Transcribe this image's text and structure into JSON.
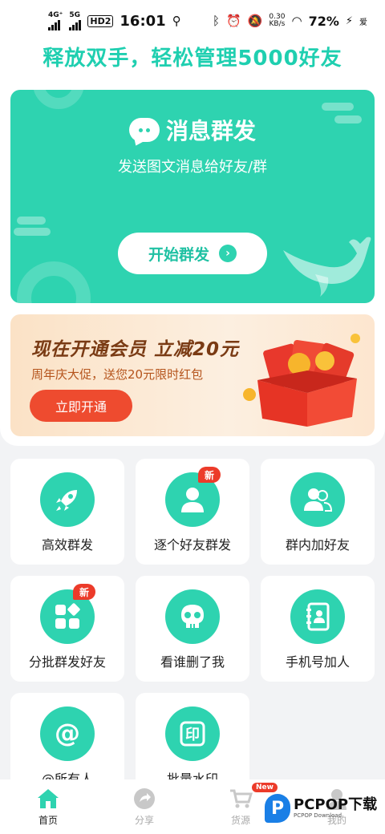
{
  "status_bar": {
    "net1": "4G⁺",
    "net2": "5G",
    "hd": "HD2",
    "time": "16:01",
    "speed_value": "0.30",
    "speed_unit": "KB/s",
    "battery": "72%",
    "carrier_note": "爱"
  },
  "headline": "释放双手，轻松管理5000好友",
  "hero": {
    "title": "消息群发",
    "subtitle": "发送图文消息给好友/群",
    "button_label": "开始群发",
    "color": "#2ed3b0"
  },
  "promo": {
    "title": "现在开通会员  立减20元",
    "subtitle": "周年庆大促，送您20元限时红包",
    "button_label": "立即开通"
  },
  "tiles": [
    {
      "label": "高效群发",
      "icon": "rocket-icon",
      "badge": ""
    },
    {
      "label": "逐个好友群发",
      "icon": "person-icon",
      "badge": "新"
    },
    {
      "label": "群内加好友",
      "icon": "people-icon",
      "badge": ""
    },
    {
      "label": "分批群发好友",
      "icon": "grid-icon",
      "badge": "新"
    },
    {
      "label": "看谁删了我",
      "icon": "skull-icon",
      "badge": ""
    },
    {
      "label": "手机号加人",
      "icon": "contact-book-icon",
      "badge": ""
    },
    {
      "label": "@所有人",
      "icon": "at-icon",
      "badge": ""
    },
    {
      "label": "批量水印",
      "icon": "stamp-icon",
      "badge": ""
    }
  ],
  "nav": [
    {
      "label": "首页",
      "icon": "home-icon",
      "active": true
    },
    {
      "label": "分享",
      "icon": "share-icon",
      "active": false
    },
    {
      "label": "货源",
      "icon": "cart-icon",
      "active": false,
      "badge": "New"
    },
    {
      "label": "我的",
      "icon": "user-icon",
      "active": false
    }
  ],
  "watermark": {
    "brand": "PCPOP下载",
    "sub": "PCPOP Download"
  }
}
